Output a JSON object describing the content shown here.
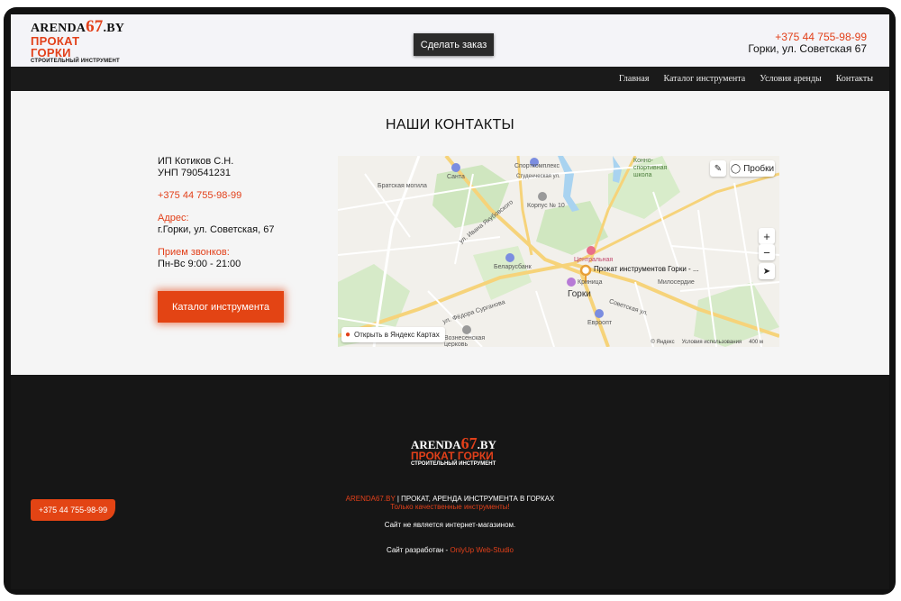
{
  "header": {
    "logo": {
      "brand_text": "ARENDA",
      "brand_num": "67",
      "brand_tld": ".BY",
      "line2": "ПРОКАТ ГОРКИ",
      "line3": "СТРОИТЕЛЬНЫЙ ИНСТРУМЕНТ"
    },
    "order_button": "Сделать заказ",
    "phone": "+375 44 755-98-99",
    "address": "Горки, ул. Советская 67"
  },
  "nav": [
    "Главная",
    "Каталог инструмента",
    "Условия аренды",
    "Контакты"
  ],
  "contacts": {
    "title": "НАШИ КОНТАКТЫ",
    "owner": "ИП Котиков С.Н.",
    "unp": "УНП 790541231",
    "phone": "+375 44 755-98-99",
    "address_label": "Адрес:",
    "address": "г.Горки, ул. Советская, 67",
    "hours_label": "Прием звонков:",
    "hours": "Пн-Вс 9:00 - 21:00",
    "catalog_button": "Каталог инструмента"
  },
  "map": {
    "traffic_button": "Пробки",
    "open_button": "Открыть в Яндекс Картах",
    "copyright": "© Яндекс",
    "terms": "Условия использования",
    "scale": "400 м",
    "labels": {
      "santa": "Санта",
      "sportcomplex": "Спорткомплекс",
      "student": "Студенческая ул.",
      "korpus": "Корпус № 10",
      "konno": "Конно-спортивная школа",
      "belarusbank": "Беларусбанк",
      "central": "Центральная",
      "krinitsa": "Криница",
      "marker": "Прокат инструментов Горки - ...",
      "miloserdie": "Милосердие",
      "gorki": "Горки",
      "euroopt": "Евроопт",
      "voznesenskaya": "Вознесенская церковь",
      "bratskaya": "Братская могила",
      "surganova": "ул. Фёдора Сурганова",
      "sovetskaya": "Советская ул.",
      "yakubovskogo": "ул. Ивана Якубовского"
    }
  },
  "footer": {
    "logo": {
      "brand_text": "ARENDA",
      "brand_num": "67",
      "brand_tld": ".BY",
      "line2": "ПРОКАТ ГОРКИ",
      "line3": "СТРОИТЕЛЬНЫЙ ИНСТРУМЕНТ"
    },
    "site": "ARENDA67.BY",
    "tagline": " | ПРОКАТ, АРЕНДА ИНСТРУМЕНТА В ГОРКАХ",
    "quality": "Только качественные инструменты!",
    "disclaimer": "Сайт не является интернет-магазином.",
    "dev_prefix": "Сайт разработан - ",
    "dev_name": "OnlyUp Web-Studio",
    "float_phone": "+375 44 755-98-99"
  },
  "colors": {
    "accent": "#e2401a",
    "dark": "#161616"
  }
}
